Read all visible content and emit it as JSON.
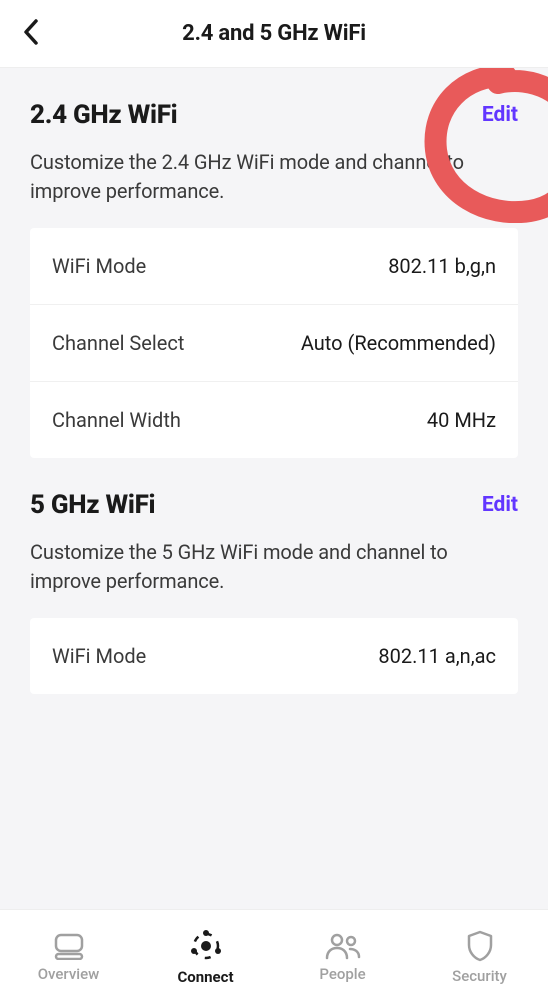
{
  "header": {
    "title": "2.4 and 5 GHz WiFi"
  },
  "sections": {
    "band24": {
      "title": "2.4 GHz WiFi",
      "edit_label": "Edit",
      "description": "Customize the 2.4 GHz WiFi mode and channel to improve performance.",
      "rows": {
        "wifi_mode": {
          "label": "WiFi Mode",
          "value": "802.11 b,g,n"
        },
        "channel_select": {
          "label": "Channel Select",
          "value": "Auto (Recommended)"
        },
        "channel_width": {
          "label": "Channel Width",
          "value": "40 MHz"
        }
      }
    },
    "band5": {
      "title": "5 GHz WiFi",
      "edit_label": "Edit",
      "description": "Customize the 5 GHz WiFi mode and channel to improve performance.",
      "rows": {
        "wifi_mode": {
          "label": "WiFi Mode",
          "value": "802.11 a,n,ac"
        }
      }
    }
  },
  "nav": {
    "overview": "Overview",
    "connect": "Connect",
    "people": "People",
    "security": "Security"
  },
  "colors": {
    "accent": "#6236ff",
    "annotation": "#e85a5a"
  }
}
